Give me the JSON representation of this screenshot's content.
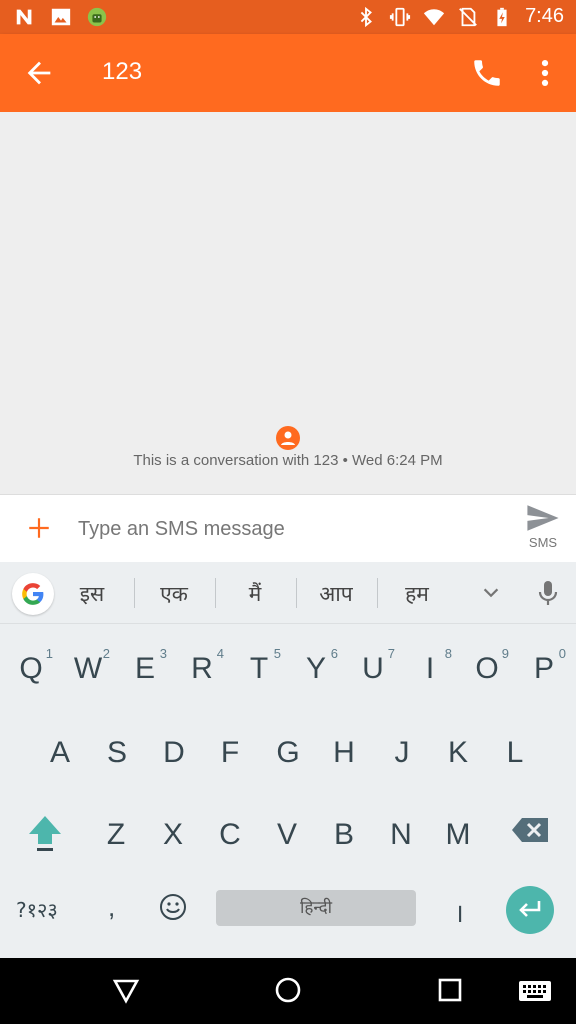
{
  "status_bar": {
    "time": "7:46",
    "icons": [
      "notification-n-icon",
      "image-icon",
      "android-icon",
      "bluetooth-icon",
      "vibrate-icon",
      "wifi-icon",
      "no-sim-icon",
      "battery-charging-icon"
    ]
  },
  "app_bar": {
    "title": "123",
    "back_icon": "arrow-back-icon",
    "call_icon": "phone-icon",
    "more_icon": "more-vert-icon"
  },
  "conversation": {
    "info": "This is a conversation with 123 • Wed 6:24 PM"
  },
  "composer": {
    "placeholder": "Type an SMS message",
    "send_label": "SMS"
  },
  "suggestions": {
    "words": [
      "इस",
      "एक",
      "मैं",
      "आप",
      "हम"
    ]
  },
  "keyboard": {
    "row1": [
      {
        "letter": "Q",
        "hint": "1"
      },
      {
        "letter": "W",
        "hint": "2"
      },
      {
        "letter": "E",
        "hint": "3"
      },
      {
        "letter": "R",
        "hint": "4"
      },
      {
        "letter": "T",
        "hint": "5"
      },
      {
        "letter": "Y",
        "hint": "6"
      },
      {
        "letter": "U",
        "hint": "7"
      },
      {
        "letter": "I",
        "hint": "8"
      },
      {
        "letter": "O",
        "hint": "9"
      },
      {
        "letter": "P",
        "hint": "0"
      }
    ],
    "row2": [
      "A",
      "S",
      "D",
      "F",
      "G",
      "H",
      "J",
      "K",
      "L"
    ],
    "row3": [
      "Z",
      "X",
      "C",
      "V",
      "B",
      "N",
      "M"
    ],
    "symbols_label": "?१२३",
    "comma": ",",
    "space_label": "हिन्दी",
    "period": "।"
  },
  "colors": {
    "status_bar": "#e65e1f",
    "app_bar": "#ff6a1f",
    "accent": "#ff6a1f",
    "enter_key": "#4db6ac",
    "shift_active": "#4db6ac"
  }
}
